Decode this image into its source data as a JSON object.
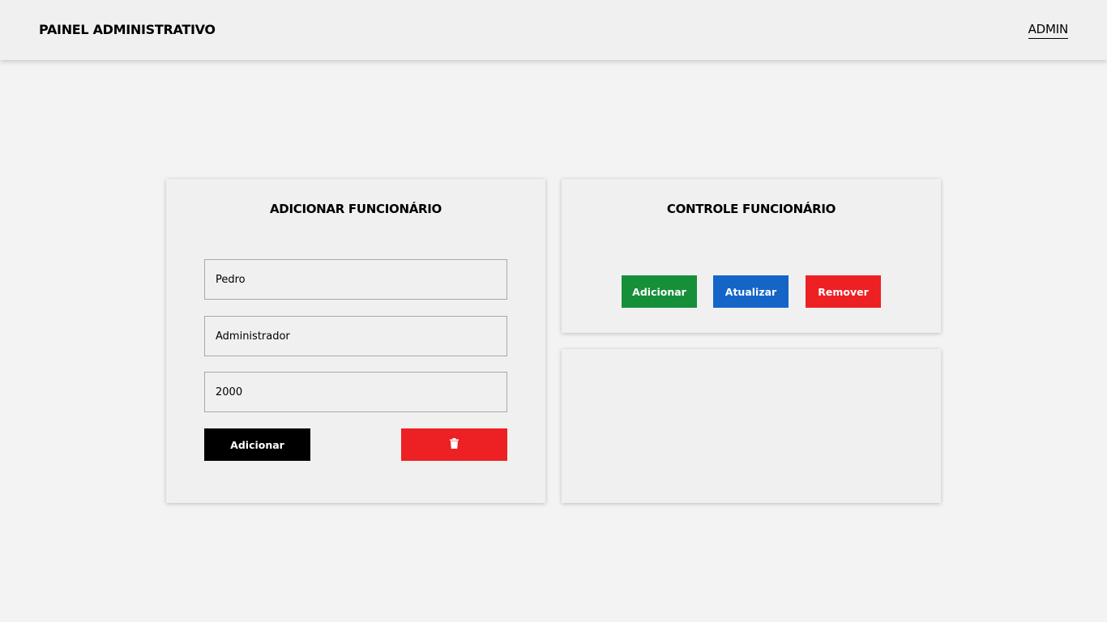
{
  "header": {
    "brand": "PAINEL ADMINISTRATIVO",
    "user_link": "ADMIN"
  },
  "add_employee": {
    "title": "ADICIONAR FUNCIONÁRIO",
    "name_value": "Pedro",
    "role_value": "Administrador",
    "salary_value": "2000",
    "submit_label": "Adicionar",
    "clear_icon": "trash-icon"
  },
  "employee_control": {
    "title": "CONTROLE FUNCIONÁRIO",
    "add_label": "Adicionar",
    "update_label": "Atualizar",
    "remove_label": "Remover"
  },
  "colors": {
    "add": "#168f39",
    "update": "#1565c8",
    "remove": "#ed2024",
    "submit": "#000000"
  }
}
